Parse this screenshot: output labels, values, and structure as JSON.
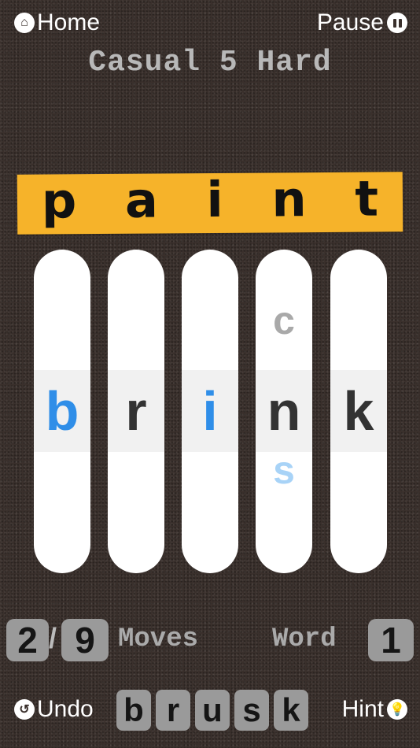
{
  "header": {
    "home_label": "Home",
    "pause_label": "Pause",
    "level_title": "Casual 5 Hard"
  },
  "target_word": [
    "p",
    "a",
    "i",
    "n",
    "t"
  ],
  "columns": [
    {
      "above": "",
      "current": "b",
      "below": "",
      "color": "#2f8ee8"
    },
    {
      "above": "",
      "current": "r",
      "below": "",
      "color": "#333333"
    },
    {
      "above": "",
      "current": "i",
      "below": "",
      "color": "#2f8ee8"
    },
    {
      "above": "c",
      "current": "n",
      "below": "s",
      "color": "#333333"
    },
    {
      "above": "",
      "current": "k",
      "below": "",
      "color": "#333333"
    }
  ],
  "stats": {
    "moves_current": "2",
    "moves_separator": "/",
    "moves_max": "9",
    "moves_label": "Moves",
    "word_label": "Word",
    "word_number": "1"
  },
  "footer": {
    "undo_label": "Undo",
    "hint_label": "Hint",
    "start_word": [
      "b",
      "r",
      "u",
      "s",
      "k"
    ]
  },
  "icons": {
    "home": "home-icon",
    "pause": "pause-icon",
    "undo": "undo-icon",
    "hint": "lightbulb-icon"
  }
}
